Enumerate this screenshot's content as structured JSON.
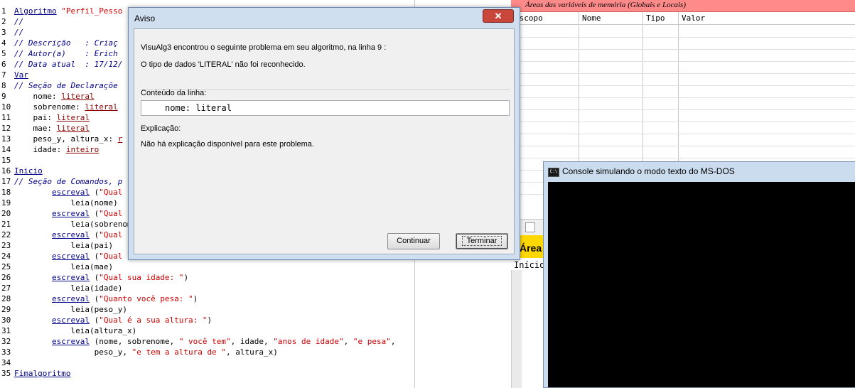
{
  "editor": {
    "lines": [
      {
        "n": "1",
        "t": [
          {
            "c": "kw",
            "v": "Algoritmo"
          },
          {
            "c": "tx",
            "v": " "
          },
          {
            "c": "st",
            "v": "\"Perfil_Pesso"
          }
        ]
      },
      {
        "n": "2",
        "t": [
          {
            "c": "cm",
            "v": "//"
          }
        ]
      },
      {
        "n": "3",
        "t": [
          {
            "c": "cm",
            "v": "//"
          }
        ]
      },
      {
        "n": "4",
        "t": [
          {
            "c": "cm",
            "v": "// Descrição   : Criaç"
          }
        ]
      },
      {
        "n": "5",
        "t": [
          {
            "c": "cm",
            "v": "// Autor(a)    : Erich"
          }
        ]
      },
      {
        "n": "6",
        "t": [
          {
            "c": "cm",
            "v": "// Data atual  : 17/12/"
          }
        ]
      },
      {
        "n": "7",
        "t": [
          {
            "c": "kw",
            "v": "Var"
          }
        ]
      },
      {
        "n": "8",
        "t": [
          {
            "c": "cm",
            "v": "// Seção de Declaraçõe"
          }
        ]
      },
      {
        "n": "9",
        "t": [
          {
            "c": "tx",
            "v": "    nome: "
          },
          {
            "c": "tp",
            "v": "literal"
          }
        ]
      },
      {
        "n": "10",
        "t": [
          {
            "c": "tx",
            "v": "    sobrenome: "
          },
          {
            "c": "tp",
            "v": "literal"
          }
        ]
      },
      {
        "n": "11",
        "t": [
          {
            "c": "tx",
            "v": "    pai: "
          },
          {
            "c": "tp",
            "v": "literal"
          }
        ]
      },
      {
        "n": "12",
        "t": [
          {
            "c": "tx",
            "v": "    mae: "
          },
          {
            "c": "tp",
            "v": "literal"
          }
        ]
      },
      {
        "n": "13",
        "t": [
          {
            "c": "tx",
            "v": "    peso_y, altura_x: "
          },
          {
            "c": "tp",
            "v": "r"
          }
        ]
      },
      {
        "n": "14",
        "t": [
          {
            "c": "tx",
            "v": "    idade: "
          },
          {
            "c": "tp",
            "v": "inteiro"
          }
        ]
      },
      {
        "n": "15",
        "t": []
      },
      {
        "n": "16",
        "t": [
          {
            "c": "kw",
            "v": "Inicio"
          }
        ]
      },
      {
        "n": "17",
        "t": [
          {
            "c": "cm",
            "v": "// Seção de Comandos, p"
          }
        ]
      },
      {
        "n": "18",
        "t": [
          {
            "c": "tx",
            "v": "        "
          },
          {
            "c": "kw",
            "v": "escreval"
          },
          {
            "c": "tx",
            "v": " ("
          },
          {
            "c": "st",
            "v": "\"Qual"
          }
        ]
      },
      {
        "n": "19",
        "t": [
          {
            "c": "tx",
            "v": "            leia(nome)"
          }
        ]
      },
      {
        "n": "20",
        "t": [
          {
            "c": "tx",
            "v": "        "
          },
          {
            "c": "kw",
            "v": "escreval"
          },
          {
            "c": "tx",
            "v": " ("
          },
          {
            "c": "st",
            "v": "\"Qual"
          }
        ]
      },
      {
        "n": "21",
        "t": [
          {
            "c": "tx",
            "v": "            leia(sobrenom"
          }
        ]
      },
      {
        "n": "22",
        "t": [
          {
            "c": "tx",
            "v": "        "
          },
          {
            "c": "kw",
            "v": "escreval"
          },
          {
            "c": "tx",
            "v": " ("
          },
          {
            "c": "st",
            "v": "\"Qual"
          }
        ]
      },
      {
        "n": "23",
        "t": [
          {
            "c": "tx",
            "v": "            leia(pai)"
          }
        ]
      },
      {
        "n": "24",
        "t": [
          {
            "c": "tx",
            "v": "        "
          },
          {
            "c": "kw",
            "v": "escreval"
          },
          {
            "c": "tx",
            "v": " ("
          },
          {
            "c": "st",
            "v": "\"Qual"
          }
        ]
      },
      {
        "n": "25",
        "t": [
          {
            "c": "tx",
            "v": "            leia(mae)"
          }
        ]
      },
      {
        "n": "26",
        "t": [
          {
            "c": "tx",
            "v": "        "
          },
          {
            "c": "kw",
            "v": "escreval"
          },
          {
            "c": "tx",
            "v": " ("
          },
          {
            "c": "st",
            "v": "\"Qual sua idade: \""
          },
          {
            "c": "tx",
            "v": ")"
          }
        ]
      },
      {
        "n": "27",
        "t": [
          {
            "c": "tx",
            "v": "            leia(idade)"
          }
        ]
      },
      {
        "n": "28",
        "t": [
          {
            "c": "tx",
            "v": "        "
          },
          {
            "c": "kw",
            "v": "escreval"
          },
          {
            "c": "tx",
            "v": " ("
          },
          {
            "c": "st",
            "v": "\"Quanto você pesa: \""
          },
          {
            "c": "tx",
            "v": ")"
          }
        ]
      },
      {
        "n": "29",
        "t": [
          {
            "c": "tx",
            "v": "            leia(peso_y)"
          }
        ]
      },
      {
        "n": "30",
        "t": [
          {
            "c": "tx",
            "v": "        "
          },
          {
            "c": "kw",
            "v": "escreval"
          },
          {
            "c": "tx",
            "v": " ("
          },
          {
            "c": "st",
            "v": "\"Qual é a sua altura: \""
          },
          {
            "c": "tx",
            "v": ")"
          }
        ]
      },
      {
        "n": "31",
        "t": [
          {
            "c": "tx",
            "v": "            leia(altura_x)"
          }
        ]
      },
      {
        "n": "32",
        "t": [
          {
            "c": "tx",
            "v": "        "
          },
          {
            "c": "kw",
            "v": "escreval"
          },
          {
            "c": "tx",
            "v": " (nome, sobrenome, "
          },
          {
            "c": "st",
            "v": "\" você tem\""
          },
          {
            "c": "tx",
            "v": ", idade, "
          },
          {
            "c": "st",
            "v": "\"anos de idade\""
          },
          {
            "c": "tx",
            "v": ", "
          },
          {
            "c": "st",
            "v": "\"e pesa\""
          },
          {
            "c": "tx",
            "v": ","
          }
        ]
      },
      {
        "n": "33",
        "t": [
          {
            "c": "tx",
            "v": "                 peso_y, "
          },
          {
            "c": "st",
            "v": "\"e tem a altura de \""
          },
          {
            "c": "tx",
            "v": ", altura_x)"
          }
        ]
      },
      {
        "n": "34",
        "t": []
      },
      {
        "n": "35",
        "t": [
          {
            "c": "kw",
            "v": "Fimalgoritmo"
          }
        ]
      }
    ]
  },
  "vars_panel": {
    "title": "Áreas das variáveis de memória (Globais e Locais)",
    "columns": [
      "Escopo",
      "Nome",
      "Tipo",
      "Valor"
    ]
  },
  "exec_panel": {
    "header": "Área",
    "text": "Início"
  },
  "console": {
    "title": "Console simulando o modo texto do MS-DOS",
    "icon_label": "C:\\"
  },
  "dialog": {
    "title": "Aviso",
    "close_symbol": "✕",
    "message": "VisuAlg3 encontrou o seguinte problema em seu algoritmo, na linha 9 :",
    "problem": "O tipo de dados 'LITERAL' não foi reconhecido.",
    "line_label": "Conteúdo da linha:",
    "line_content": "nome: literal",
    "explanation_label": "Explicação:",
    "explanation": "Não há explicação disponível para este problema.",
    "continue_label": "Continuar",
    "terminate_label": "Terminar"
  },
  "colors": {
    "vars_title_bg": "#ff8a8a",
    "exec_header_bg": "#ffd800",
    "close_button": "#c9473a",
    "keyword": "#00008b",
    "string": "#cc0000"
  }
}
